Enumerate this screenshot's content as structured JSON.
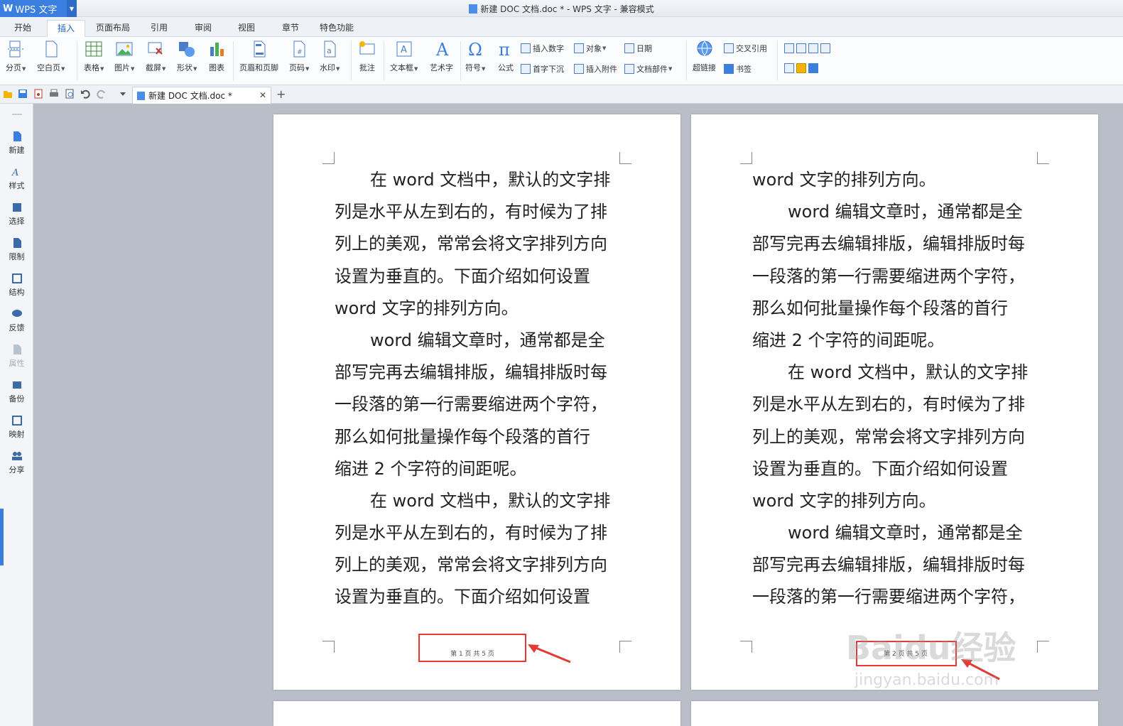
{
  "app": {
    "name": "WPS 文字",
    "window_title": "新建 DOC 文档.doc * - WPS 文字 - 兼容模式"
  },
  "tabs": [
    "开始",
    "插入",
    "页面布局",
    "引用",
    "审阅",
    "视图",
    "章节",
    "特色功能"
  ],
  "active_tab": "插入",
  "ribbon": {
    "page_break": "分页",
    "blank_page": "空白页",
    "table": "表格",
    "picture": "图片",
    "screenshot": "截屏",
    "shape": "形状",
    "chart": "图表",
    "header_footer": "页眉和页脚",
    "page_number": "页码",
    "watermark": "水印",
    "comment": "批注",
    "textbox": "文本框",
    "wordart": "艺术字",
    "symbol": "符号",
    "formula": "公式",
    "insert_number": "插入数字",
    "object": "对象",
    "date": "日期",
    "drop_cap": "首字下沉",
    "insert_attachment": "插入附件",
    "doc_parts": "文档部件",
    "hyperlink": "超链接",
    "cross_ref": "交叉引用",
    "bookmark": "书签"
  },
  "doc_tab": "新建 DOC 文档.doc *",
  "sidebar": [
    "新建",
    "样式",
    "选择",
    "限制",
    "结构",
    "反馈",
    "属性",
    "备份",
    "映射",
    "分享"
  ],
  "page1": {
    "lines": [
      "在 word 文档中，默认的文字排",
      "列是水平从左到右的，有时候为了排",
      "列上的美观，常常会将文字排列方向",
      "设置为垂直的。下面介绍如何设置",
      "word 文字的排列方向。",
      "word 编辑文章时，通常都是全",
      "部写完再去编辑排版，编辑排版时每",
      "一段落的第一行需要缩进两个字符，",
      "那么如何批量操作每个段落的首行",
      "缩进 2 个字符的间距呢。",
      "在 word 文档中，默认的文字排",
      "列是水平从左到右的，有时候为了排",
      "列上的美观，常常会将文字排列方向",
      "设置为垂直的。下面介绍如何设置"
    ],
    "footer": "第 1 页 共 5 页"
  },
  "page2": {
    "lines": [
      "word 文字的排列方向。",
      "word 编辑文章时，通常都是全",
      "部写完再去编辑排版，编辑排版时每",
      "一段落的第一行需要缩进两个字符，",
      "那么如何批量操作每个段落的首行",
      "缩进 2 个字符的间距呢。",
      "在 word 文档中，默认的文字排",
      "列是水平从左到右的，有时候为了排",
      "列上的美观，常常会将文字排列方向",
      "设置为垂直的。下面介绍如何设置",
      "word 文字的排列方向。",
      "word 编辑文章时，通常都是全",
      "部写完再去编辑排版，编辑排版时每",
      "一段落的第一行需要缩进两个字符，"
    ],
    "footer": "第 2 页 共 5 页"
  },
  "watermark": {
    "logo": "Baidu经验",
    "url": "jingyan.baidu.com"
  },
  "colors": {
    "accent": "#3a7ee0",
    "annotation": "#e53935",
    "workspace": "#b9bec8"
  }
}
